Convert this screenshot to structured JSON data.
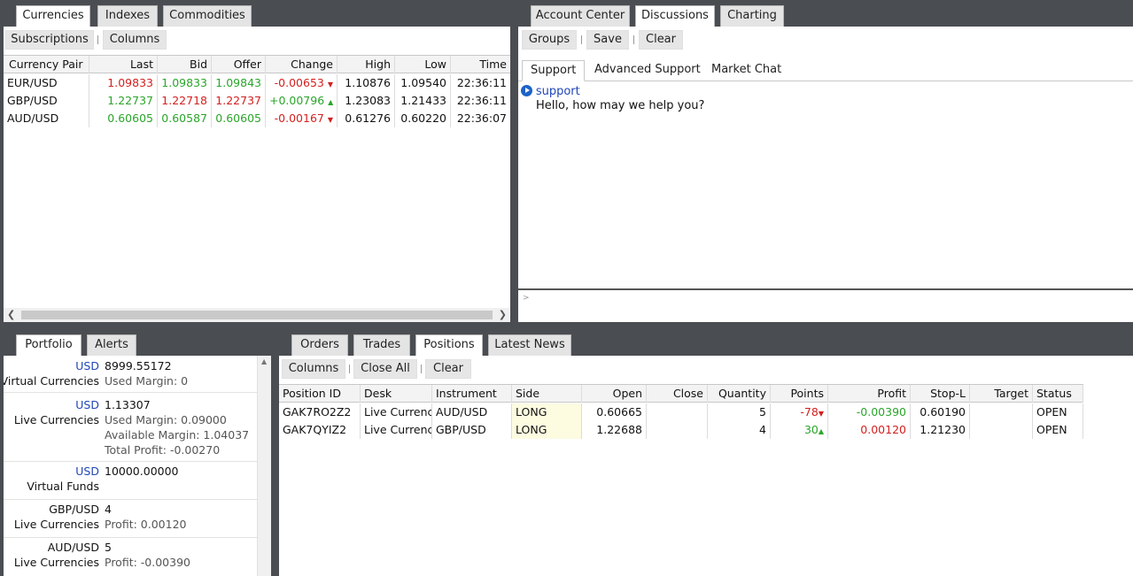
{
  "currencies_panel": {
    "tabs": [
      "Currencies",
      "Indexes",
      "Commodities"
    ],
    "toolbar": {
      "subscriptions": "Subscriptions",
      "columns": "Columns"
    },
    "columns": [
      "Currency Pair",
      "Last",
      "Bid",
      "Offer",
      "Change",
      "High",
      "Low",
      "Time"
    ],
    "rows": [
      {
        "pair": "EUR/USD",
        "last": "1.09833",
        "bid": "1.09833",
        "offer": "1.09843",
        "change": "-0.00653",
        "high": "1.10876",
        "low": "1.09540",
        "time": "22:36:11"
      },
      {
        "pair": "GBP/USD",
        "last": "1.22737",
        "bid": "1.22718",
        "offer": "1.22737",
        "change": "+0.00796",
        "high": "1.23083",
        "low": "1.21433",
        "time": "22:36:11"
      },
      {
        "pair": "AUD/USD",
        "last": "0.60605",
        "bid": "0.60587",
        "offer": "0.60605",
        "change": "-0.00167",
        "high": "0.61276",
        "low": "0.60220",
        "time": "22:36:07"
      }
    ],
    "colors": {
      "up": "#2aa52a",
      "down": "#d42020"
    }
  },
  "discussions_panel": {
    "tabs": [
      "Account Center",
      "Discussions",
      "Charting"
    ],
    "toolbar": {
      "groups": "Groups",
      "save": "Save",
      "clear": "Clear"
    },
    "subtabs": [
      "Support",
      "Advanced Support",
      "Market Chat"
    ],
    "message": {
      "sender": "support",
      "text": "Hello, how may we help you?"
    },
    "input_prompt": ">"
  },
  "portfolio_panel": {
    "tabs": [
      "Portfolio",
      "Alerts"
    ],
    "items": [
      {
        "line1_label": "USD",
        "line1_value": "8999.55172",
        "line2_label": "Virtual Currencies",
        "details": [
          "Used Margin:  0"
        ]
      },
      {
        "line1_label": "USD",
        "line1_value": "1.13307",
        "line2_label": "Live Currencies",
        "details": [
          "Used Margin:  0.09000",
          "Available Margin:  1.04037",
          "Total Profit:  -0.00270"
        ]
      },
      {
        "line1_label": "USD",
        "line1_value": "10000.00000",
        "line2_label": "Virtual Funds",
        "details": []
      },
      {
        "line1_label": "GBP/USD",
        "line1_value": "4",
        "line2_label": "Live Currencies",
        "details": [
          "Profit:  0.00120"
        ]
      },
      {
        "line1_label": "AUD/USD",
        "line1_value": "5",
        "line2_label": "Live Currencies",
        "details": [
          "Profit:  -0.00390"
        ]
      }
    ]
  },
  "positions_panel": {
    "tabs": [
      "Orders",
      "Trades",
      "Positions",
      "Latest News"
    ],
    "toolbar": {
      "columns": "Columns",
      "close_all": "Close All",
      "clear": "Clear"
    },
    "columns": [
      "Position ID",
      "Desk",
      "Instrument",
      "Side",
      "Open",
      "Close",
      "Quantity",
      "Points",
      "Profit",
      "Stop-L",
      "Target",
      "Status"
    ],
    "rows": [
      {
        "id": "GAK7RO2Z2",
        "desk": "Live Currencies",
        "instrument": "AUD/USD",
        "side": "LONG",
        "open": "0.60665",
        "close": "",
        "quantity": "5",
        "points": "-78",
        "profit": "-0.00390",
        "stop": "0.60190",
        "target": "",
        "status": "OPEN"
      },
      {
        "id": "GAK7QYIZ2",
        "desk": "Live Currencies",
        "instrument": "GBP/USD",
        "side": "LONG",
        "open": "1.22688",
        "close": "",
        "quantity": "4",
        "points": "30",
        "profit": "0.00120",
        "stop": "1.21230",
        "target": "",
        "status": "OPEN"
      }
    ]
  }
}
